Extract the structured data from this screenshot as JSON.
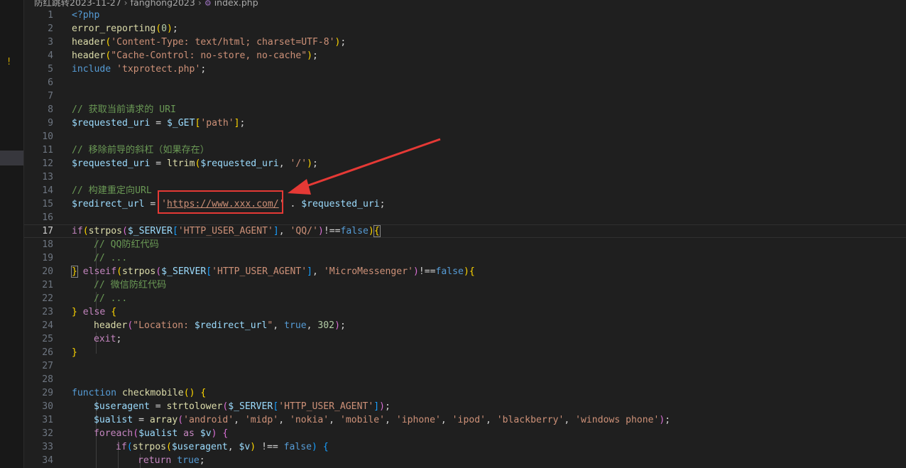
{
  "breadcrumb": {
    "folder": "防红跳转2023-11-27",
    "subfolder": "fanghong2023",
    "file": "index.php",
    "file_icon": "php-file-icon"
  },
  "activity_bar": {
    "warning_glyph": "!"
  },
  "editor": {
    "current_line": 17,
    "highlighted_text": "'https://www.xxx.com/'",
    "lines": [
      {
        "n": "1"
      },
      {
        "n": "2"
      },
      {
        "n": "3"
      },
      {
        "n": "4"
      },
      {
        "n": "5"
      },
      {
        "n": "6"
      },
      {
        "n": "7"
      },
      {
        "n": "8"
      },
      {
        "n": "9"
      },
      {
        "n": "10"
      },
      {
        "n": "11"
      },
      {
        "n": "12"
      },
      {
        "n": "13"
      },
      {
        "n": "14"
      },
      {
        "n": "15"
      },
      {
        "n": "16"
      },
      {
        "n": "17"
      },
      {
        "n": "18"
      },
      {
        "n": "19"
      },
      {
        "n": "20"
      },
      {
        "n": "21"
      },
      {
        "n": "22"
      },
      {
        "n": "23"
      },
      {
        "n": "24"
      },
      {
        "n": "25"
      },
      {
        "n": "26"
      },
      {
        "n": "27"
      },
      {
        "n": "28"
      },
      {
        "n": "29"
      },
      {
        "n": "30"
      },
      {
        "n": "31"
      },
      {
        "n": "32"
      },
      {
        "n": "33"
      },
      {
        "n": "34"
      }
    ],
    "tokens": {
      "l1": "<?php",
      "l2a": "error_reporting",
      "l2b": "(",
      "l2c": "0",
      "l2d": ")",
      "l2e": ";",
      "l3a": "header",
      "l3b": "(",
      "l3c": "'Content-Type: text/html; charset=UTF-8'",
      "l3d": ")",
      "l3e": ";",
      "l4a": "header",
      "l4b": "(",
      "l4c": "\"Cache-Control: no-store, no-cache\"",
      "l4d": ")",
      "l4e": ";",
      "l5a": "include",
      "l5b": "'txprotect.php'",
      "l5c": ";",
      "l8": "// 获取当前请求的 URI",
      "l9a": "$requested_uri",
      "l9b": " = ",
      "l9c": "$_GET",
      "l9d": "[",
      "l9e": "'path'",
      "l9f": "]",
      "l9g": ";",
      "l11": "// 移除前导的斜杠（如果存在）",
      "l12a": "$requested_uri",
      "l12b": " = ",
      "l12c": "ltrim",
      "l12d": "(",
      "l12e": "$requested_uri",
      "l12f": ", ",
      "l12g": "'/'",
      "l12h": ")",
      "l12i": ";",
      "l14": "// 构建重定向URL",
      "l15a": "$redirect_url",
      "l15b": " = ",
      "l15c": "'",
      "l15d": "https://www.xxx.com/",
      "l15e": "'",
      "l15f": " . ",
      "l15g": "$requested_uri",
      "l15h": ";",
      "l17a": "if",
      "l17b": "(",
      "l17c": "strpos",
      "l17d": "(",
      "l17e": "$_SERVER",
      "l17f": "[",
      "l17g": "'HTTP_USER_AGENT'",
      "l17h": "]",
      "l17i": ", ",
      "l17j": "'QQ/'",
      "l17k": ")",
      "l17l": "!==",
      "l17m": "false",
      "l17n": ")",
      "l17o": "{",
      "l18": "// QQ防红代码",
      "l19": "// ...",
      "l20a": "}",
      "l20b": " elseif",
      "l20c": "(",
      "l20d": "strpos",
      "l20e": "(",
      "l20f": "$_SERVER",
      "l20g": "[",
      "l20h": "'HTTP_USER_AGENT'",
      "l20i": "]",
      "l20j": ", ",
      "l20k": "'MicroMessenger'",
      "l20l": ")",
      "l20m": "!==",
      "l20n": "false",
      "l20o": ")",
      "l20p": "{",
      "l21": "// 微信防红代码",
      "l22": "// ...",
      "l23a": "}",
      "l23b": " else ",
      "l23c": "{",
      "l24a": "header",
      "l24b": "(",
      "l24c": "\"Location: ",
      "l24d": "$redirect_url",
      "l24e": "\"",
      "l24f": ", ",
      "l24g": "true",
      "l24h": ", ",
      "l24i": "302",
      "l24j": ")",
      "l24k": ";",
      "l25a": "exit",
      "l25b": ";",
      "l26": "}",
      "l29a": "function",
      "l29b": " checkmobile",
      "l29c": "() ",
      "l29d": "{",
      "l30a": "$useragent",
      "l30b": " = ",
      "l30c": "strtolower",
      "l30d": "(",
      "l30e": "$_SERVER",
      "l30f": "[",
      "l30g": "'HTTP_USER_AGENT'",
      "l30h": "]",
      "l30i": ")",
      "l30j": ";",
      "l31a": "$ualist",
      "l31b": " = ",
      "l31c": "array",
      "l31d": "(",
      "l31e": "'android'",
      "l31f": ", ",
      "l31g": "'midp'",
      "l31h": ", ",
      "l31i": "'nokia'",
      "l31j": ", ",
      "l31k": "'mobile'",
      "l31l": ", ",
      "l31m": "'iphone'",
      "l31n": ", ",
      "l31o": "'ipod'",
      "l31p": ", ",
      "l31q": "'blackberry'",
      "l31r": ", ",
      "l31s": "'windows phone'",
      "l31t": ")",
      "l31u": ";",
      "l32a": "foreach",
      "l32b": "(",
      "l32c": "$ualist",
      "l32d": " as ",
      "l32e": "$v",
      "l32f": ") ",
      "l32g": "{",
      "l33a": "if",
      "l33b": "(",
      "l33c": "strpos",
      "l33d": "(",
      "l33e": "$useragent",
      "l33f": ", ",
      "l33g": "$v",
      "l33h": ") ",
      "l33i": "!==",
      "l33j": " false",
      "l33k": ") ",
      "l33l": "{",
      "l34a": "return",
      "l34b": " true",
      "l34c": ";"
    }
  },
  "colors": {
    "annotation": "#e53935",
    "keyword": "#569cd6",
    "string": "#ce9178",
    "comment": "#6a9955"
  }
}
